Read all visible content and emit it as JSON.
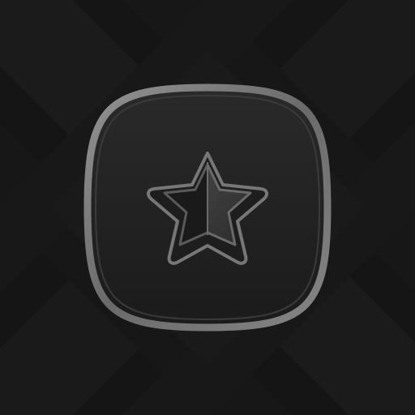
{
  "icon": {
    "name": "half-star-icon",
    "shape": "squircle",
    "background_color": "#141414",
    "frame_color": "#8a8a8a",
    "star_fill_left": "#1c1c1c",
    "star_fill_right": "#3a3a3a",
    "star_outline_color": "#6e6e6e"
  }
}
